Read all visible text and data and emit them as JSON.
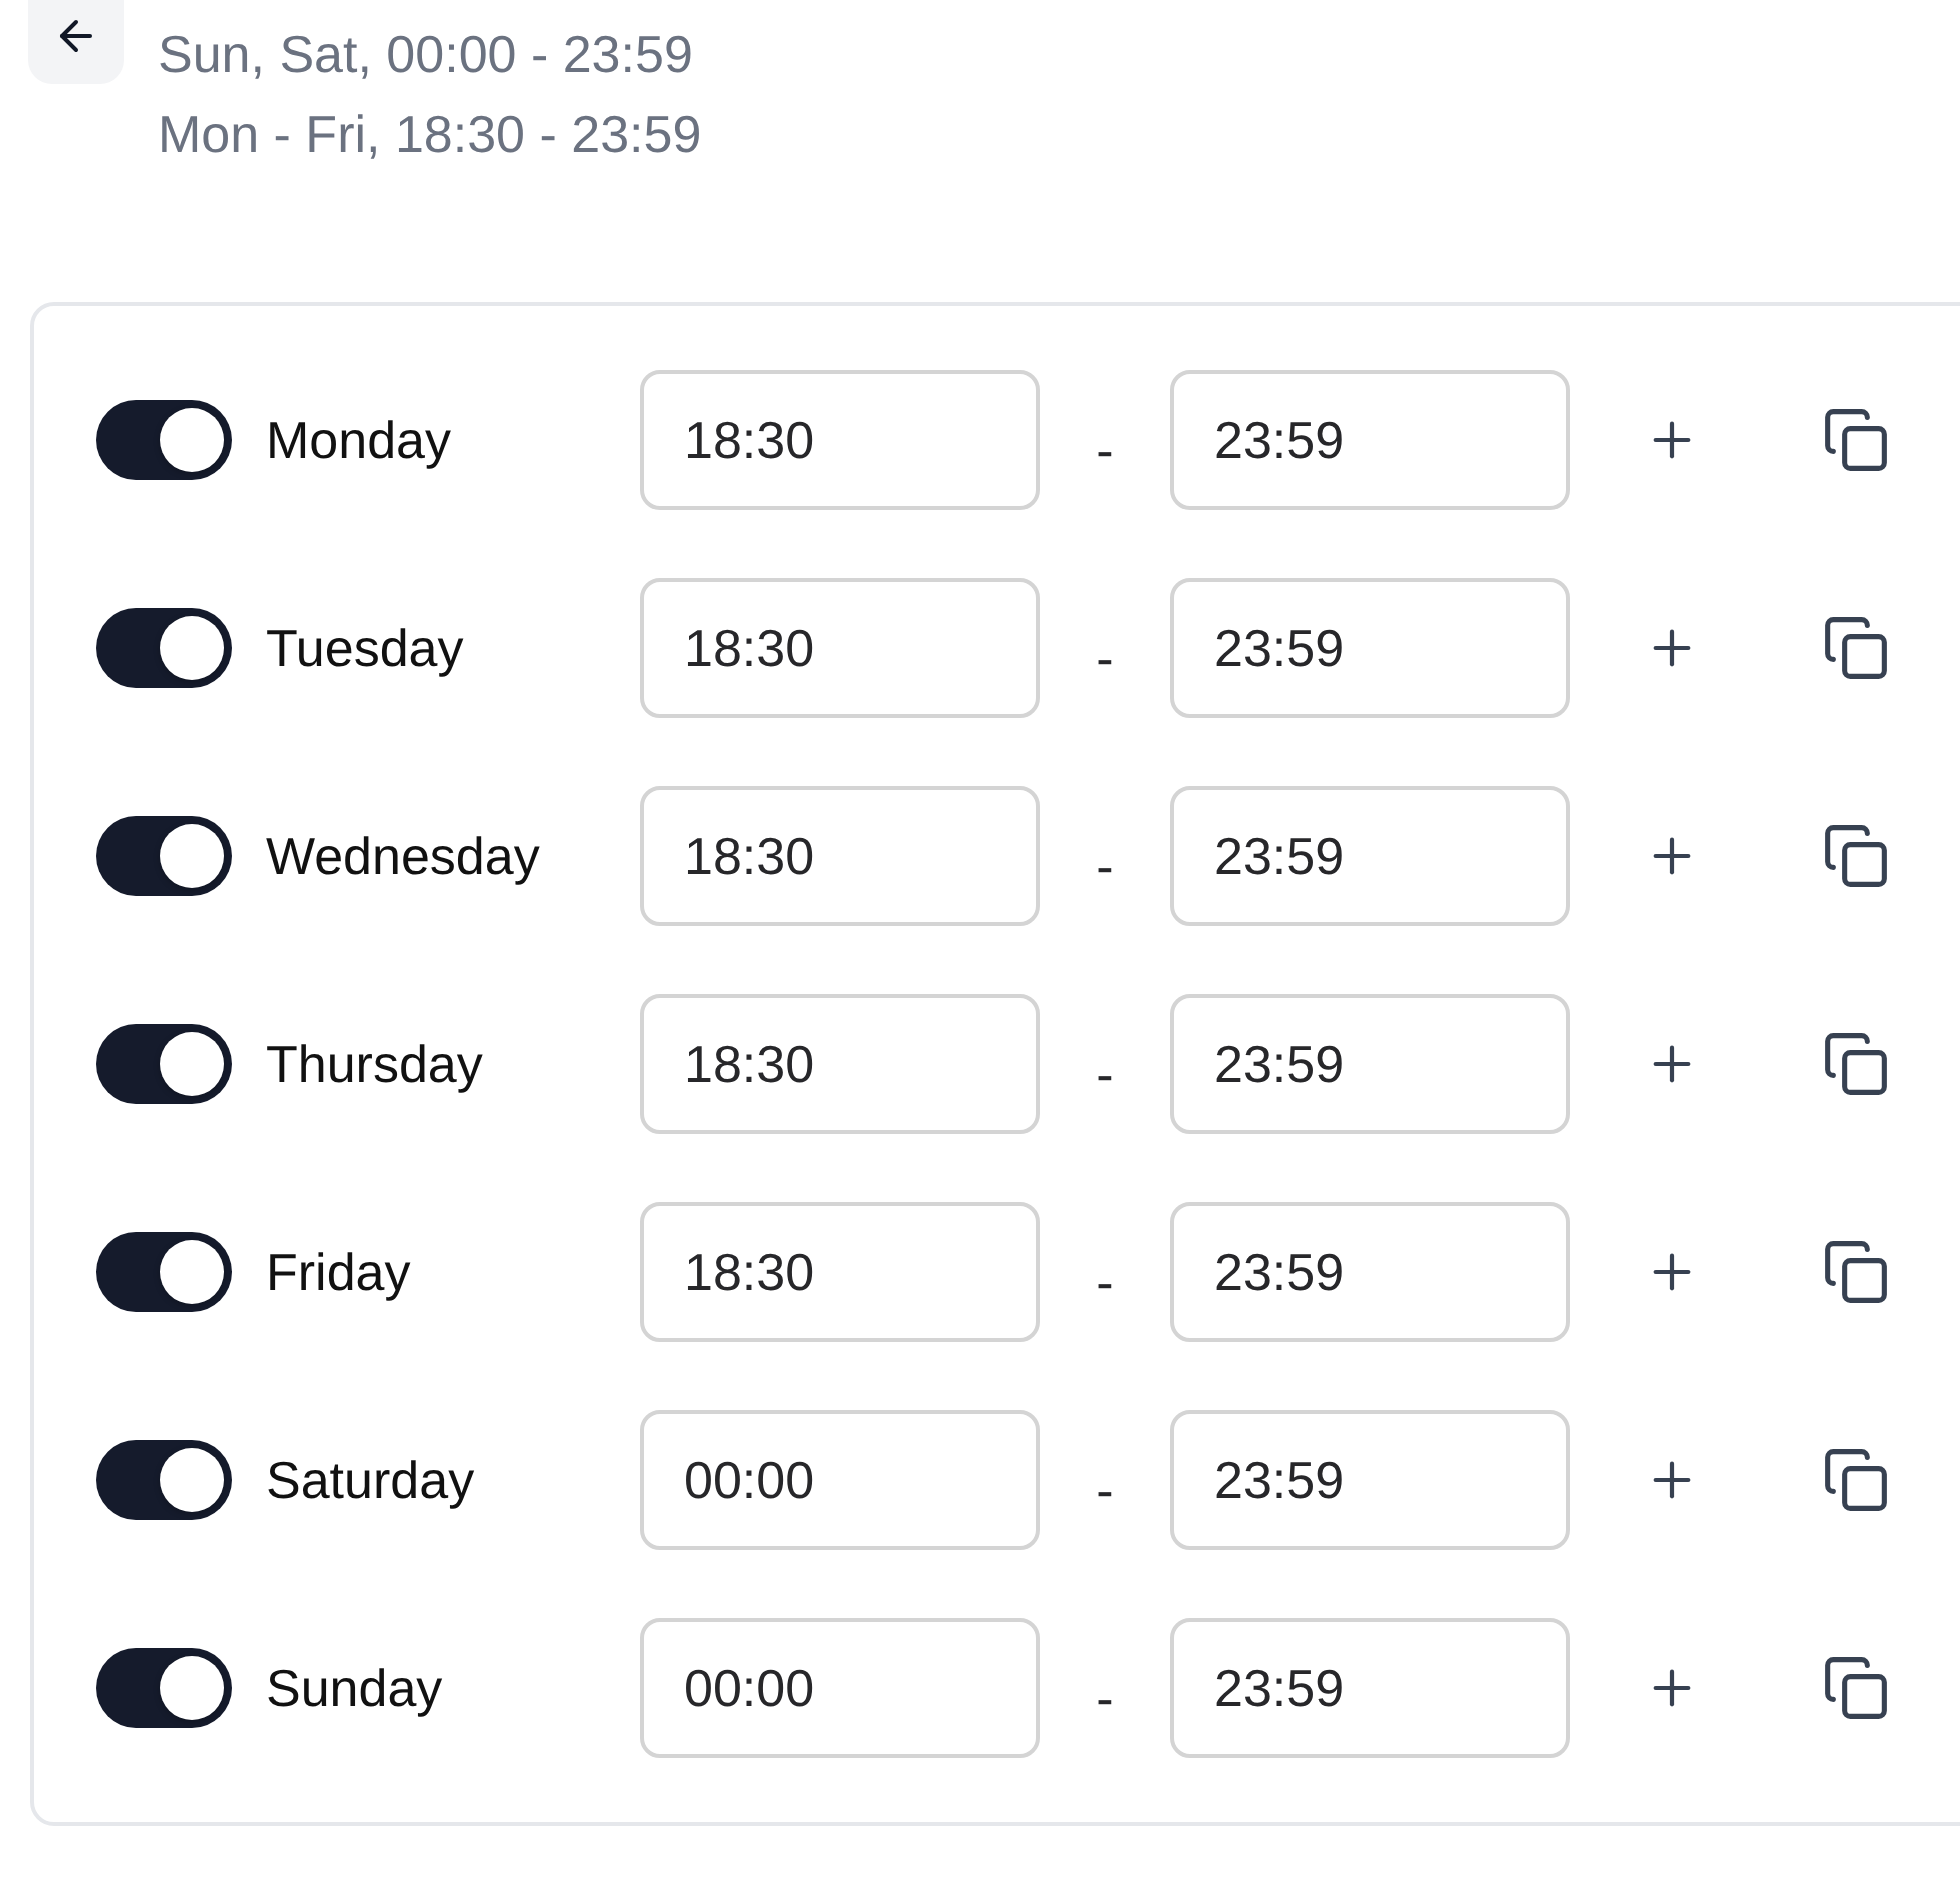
{
  "header": {
    "summary": [
      "Sun, Sat, 00:00 - 23:59",
      "Mon - Fri, 18:30 - 23:59"
    ]
  },
  "days": [
    {
      "name": "Monday",
      "enabled": true,
      "start": "18:30",
      "separator": "-",
      "end": "23:59"
    },
    {
      "name": "Tuesday",
      "enabled": true,
      "start": "18:30",
      "separator": "-",
      "end": "23:59"
    },
    {
      "name": "Wednesday",
      "enabled": true,
      "start": "18:30",
      "separator": "-",
      "end": "23:59"
    },
    {
      "name": "Thursday",
      "enabled": true,
      "start": "18:30",
      "separator": "-",
      "end": "23:59"
    },
    {
      "name": "Friday",
      "enabled": true,
      "start": "18:30",
      "separator": "-",
      "end": "23:59"
    },
    {
      "name": "Saturday",
      "enabled": true,
      "start": "00:00",
      "separator": "-",
      "end": "23:59"
    },
    {
      "name": "Sunday",
      "enabled": true,
      "start": "00:00",
      "separator": "-",
      "end": "23:59"
    }
  ]
}
